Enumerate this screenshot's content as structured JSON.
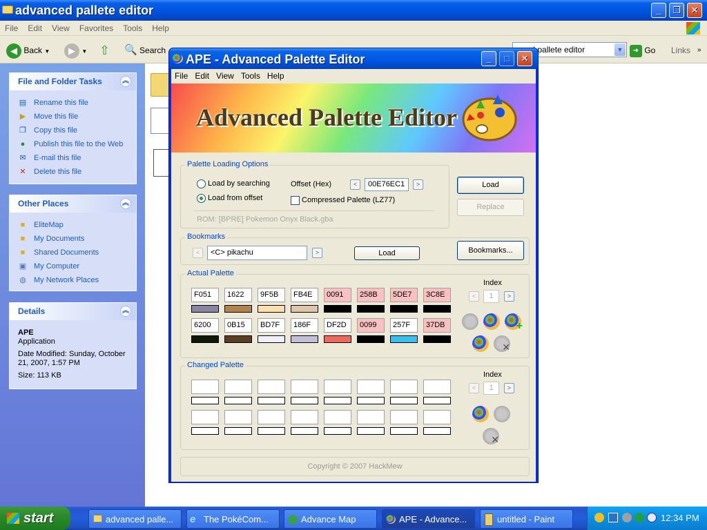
{
  "explorer": {
    "title": "advanced pallete editor",
    "menu": [
      "File",
      "Edit",
      "View",
      "Favorites",
      "Tools",
      "Help"
    ],
    "toolbar": {
      "back": "Back",
      "search": "Search",
      "go": "Go",
      "links": "Links"
    },
    "address_value": "nced pallete editor"
  },
  "sidebar": {
    "file_tasks": {
      "title": "File and Folder Tasks",
      "items": [
        "Rename this file",
        "Move this file",
        "Copy this file",
        "Publish this file to the Web",
        "E-mail this file",
        "Delete this file"
      ]
    },
    "other_places": {
      "title": "Other Places",
      "items": [
        "EliteMap",
        "My Documents",
        "Shared Documents",
        "My Computer",
        "My Network Places"
      ]
    },
    "details": {
      "title": "Details",
      "name": "APE",
      "type": "Application",
      "date_modified": "Date Modified: Sunday, October 21, 2007, 1:57 PM",
      "size": "Size: 113 KB"
    }
  },
  "ape": {
    "title": "APE - Advanced Palette Editor",
    "menu": [
      "File",
      "Edit",
      "View",
      "Tools",
      "Help"
    ],
    "banner_text": "Advanced Palette Editor",
    "loading": {
      "group_label": "Palette Loading Options",
      "radio_search": "Load by searching",
      "radio_offset": "Load from offset",
      "offset_label": "Offset (Hex)",
      "offset_value": "00E76EC1",
      "compressed_label": "Compressed Palette (LZ77)",
      "rom_text": "ROM: [BPRE] Pokemon Onyx Black.gba",
      "load_button": "Load",
      "replace_button": "Replace"
    },
    "bookmarks": {
      "group_label": "Bookmarks",
      "value": "<C> pikachu",
      "load_button": "Load",
      "bookmarks_button": "Bookmarks..."
    },
    "actual": {
      "group_label": "Actual Palette",
      "index_label": "Index",
      "index_value": "1",
      "row1": [
        {
          "hex": "F051",
          "color": "#8c84a4",
          "pink": false
        },
        {
          "hex": "1622",
          "color": "#b0844a",
          "pink": false
        },
        {
          "hex": "9F5B",
          "color": "#ffe0ad",
          "pink": false
        },
        {
          "hex": "FB4E",
          "color": "#dfc6a8",
          "pink": false
        },
        {
          "hex": "0091",
          "color": "#000000",
          "pink": true
        },
        {
          "hex": "258B",
          "color": "#000000",
          "pink": true
        },
        {
          "hex": "5DE7",
          "color": "#000000",
          "pink": true
        },
        {
          "hex": "3C8E",
          "color": "#000000",
          "pink": true
        }
      ],
      "row2": [
        {
          "hex": "6200",
          "color": "#101808",
          "pink": false
        },
        {
          "hex": "0B15",
          "color": "#5a4020",
          "pink": false
        },
        {
          "hex": "BD7F",
          "color": "#f0f0fa",
          "pink": false
        },
        {
          "hex": "186F",
          "color": "#c0c0d8",
          "pink": false
        },
        {
          "hex": "DF2D",
          "color": "#ef6a5a",
          "pink": false
        },
        {
          "hex": "0099",
          "color": "#000000",
          "pink": true
        },
        {
          "hex": "257F",
          "color": "#38c0f0",
          "pink": false
        },
        {
          "hex": "37DB",
          "color": "#000000",
          "pink": true
        }
      ]
    },
    "changed": {
      "group_label": "Changed Palette",
      "index_label": "Index",
      "index_value": "1"
    },
    "copyright": "Copyright © 2007 HackMew"
  },
  "taskbar": {
    "start": "start",
    "tasks": [
      "advanced palle...",
      "The PokéCom...",
      "Advance Map",
      "APE - Advance...",
      "untitled - Paint"
    ],
    "clock": "12:34 PM"
  }
}
